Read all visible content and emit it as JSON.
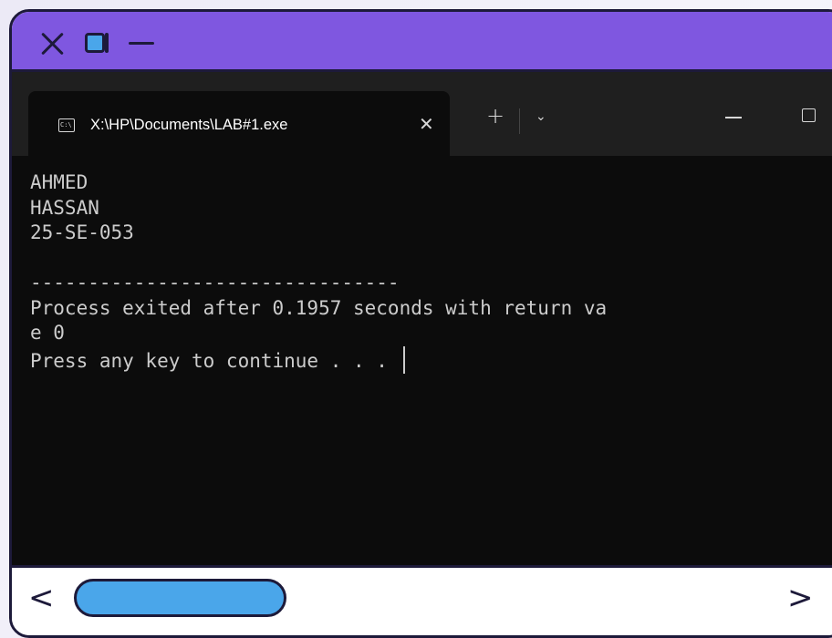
{
  "frame": {
    "colors": {
      "top_bar": "#7f57e0",
      "outline": "#1d1a3a",
      "accent": "#4aa6ea"
    },
    "controls": [
      "close-icon",
      "maximize-icon",
      "minimize-icon"
    ]
  },
  "terminal": {
    "tab": {
      "title": "X:\\HP\\Documents\\LAB#1.exe",
      "icon": "console-icon",
      "icon_text": "C:\\",
      "close_glyph": "✕"
    },
    "new_tab_glyph": "+",
    "dropdown_glyph": "⌄",
    "window_controls": [
      "minimize-icon",
      "maximize-icon"
    ],
    "output": [
      "AHMED",
      "HASSAN",
      "25-SE-053",
      "",
      "--------------------------------",
      "Process exited after 0.1957 seconds with return va",
      "e 0",
      "Press any key to continue . . . "
    ]
  },
  "scrollbar": {
    "left_glyph": "<",
    "right_glyph": ">"
  }
}
